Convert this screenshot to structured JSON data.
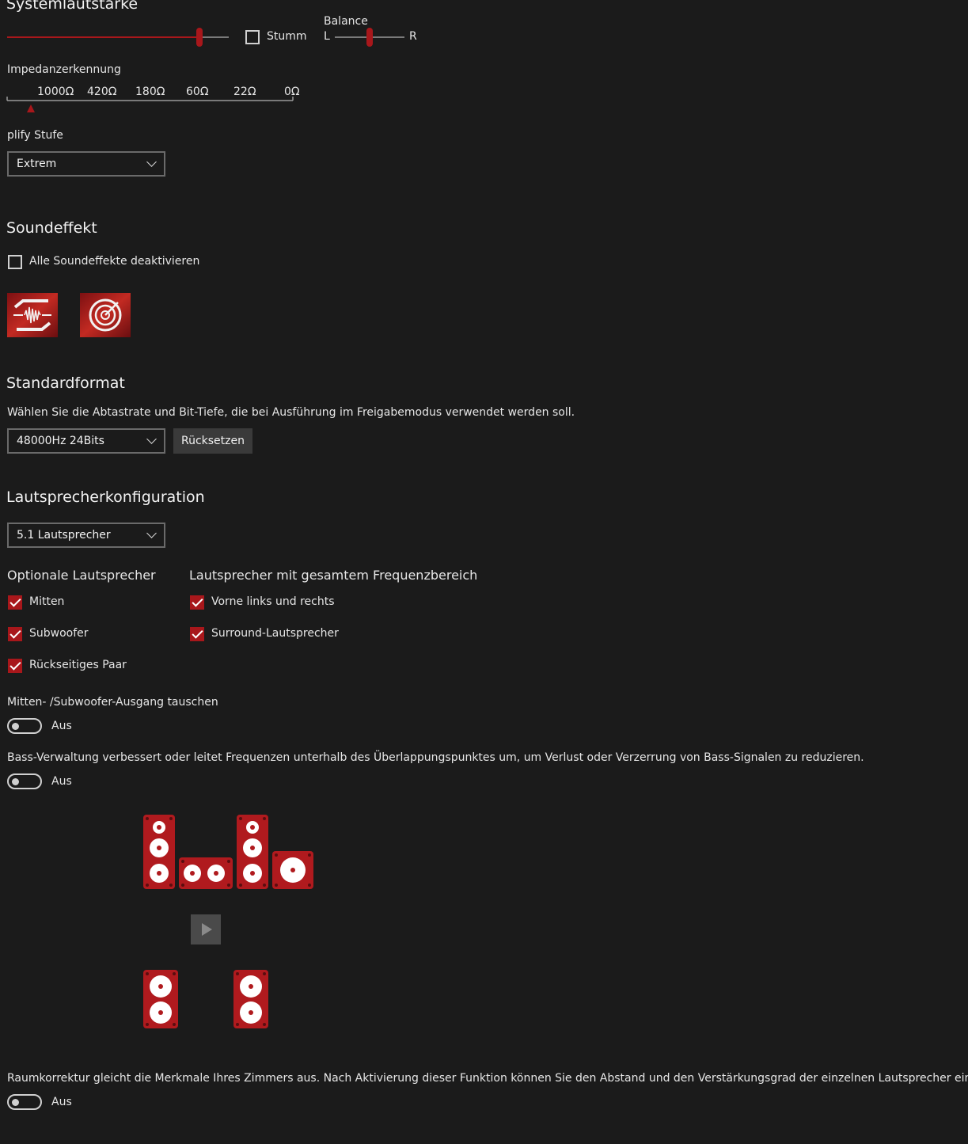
{
  "volume": {
    "title": "Systemlautstärke",
    "level_percent": 87,
    "mute_label": "Stumm",
    "mute_checked": false,
    "balance_label": "Balance",
    "balance_left": "L",
    "balance_right": "R",
    "balance_position_percent": 50
  },
  "impedance": {
    "title": "Impedanzerkennung",
    "ticks": [
      "1000Ω",
      "420Ω",
      "180Ω",
      "60Ω",
      "22Ω",
      "0Ω"
    ],
    "marker_color": "#a8171b"
  },
  "amplify": {
    "title": "plify Stufe",
    "selected": "Extrem"
  },
  "soundeffect": {
    "title": "Soundeffekt",
    "disable_all_label": "Alle Soundeffekte deaktivieren",
    "disable_all_checked": false,
    "icons": [
      "sonic-studio-icon",
      "sonic-radar-icon"
    ]
  },
  "format": {
    "title": "Standardformat",
    "description": "Wählen Sie die Abtastrate und Bit-Tiefe, die bei Ausführung im Freigabemodus verwendet werden soll.",
    "selected": "48000Hz 24Bits",
    "reset_label": "Rücksetzen"
  },
  "speakers": {
    "title": "Lautsprecherkonfiguration",
    "selected": "5.1 Lautsprecher",
    "optional_title": "Optionale Lautsprecher",
    "optional": [
      {
        "label": "Mitten",
        "checked": true
      },
      {
        "label": "Subwoofer",
        "checked": true
      },
      {
        "label": "Rückseitiges Paar",
        "checked": true
      }
    ],
    "fullrange_title": "Lautsprecher mit gesamtem Frequenzbereich",
    "fullrange": [
      {
        "label": "Vorne links und rechts",
        "checked": true
      },
      {
        "label": "Surround-Lautsprecher",
        "checked": true
      }
    ],
    "swap_title": "Mitten- /Subwoofer-Ausgang tauschen",
    "swap_state": "Aus",
    "bass_title": "Bass-Verwaltung verbessert oder leitet Frequenzen unterhalb des Überlappungspunktes um, um Verlust oder Verzerrung von Bass-Signalen zu reduzieren.",
    "bass_state": "Aus",
    "room_title": "Raumkorrektur gleicht die Merkmale Ihres Zimmers aus. Nach Aktivierung dieser Funktion können Sie den Abstand und den Verstärkungsgrad der einzelnen Lautsprecher einstellen.",
    "room_state": "Aus"
  },
  "colors": {
    "accent": "#a8171b",
    "speaker": "#b01a1e",
    "background": "#1b1b1b"
  }
}
